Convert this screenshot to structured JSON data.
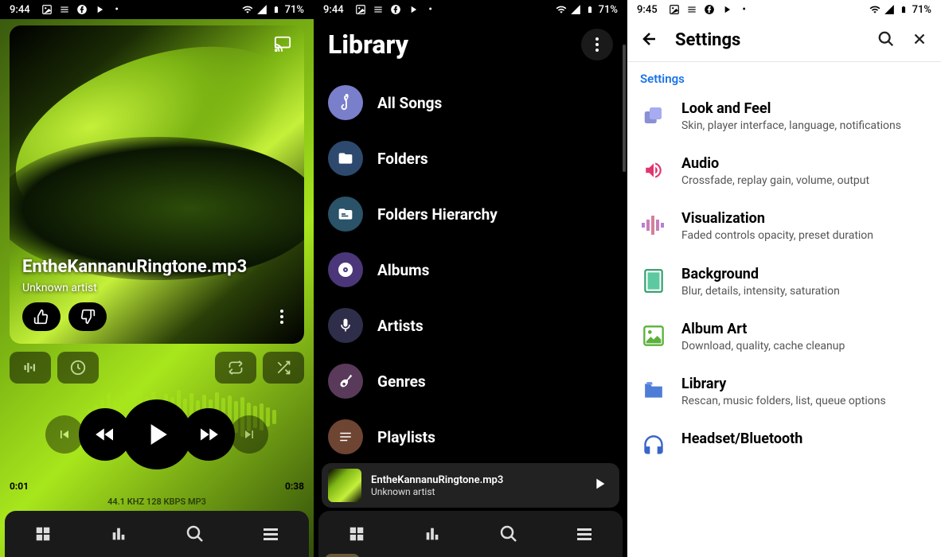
{
  "status": {
    "time1": "9:44",
    "time2": "9:44",
    "time3": "9:45",
    "battery": "71%"
  },
  "player": {
    "track_title": "EntheKannanuRingtone.mp3",
    "artist": "Unknown artist",
    "elapsed": "0:01",
    "total": "0:38",
    "format": "44.1 KHZ  128 KBPS  MP3"
  },
  "library": {
    "title": "Library",
    "items": [
      {
        "label": "All Songs",
        "icon": "treble-clef-icon",
        "color": "#7a7fcb"
      },
      {
        "label": "Folders",
        "icon": "folder-icon",
        "color": "#2d4a6e"
      },
      {
        "label": "Folders Hierarchy",
        "icon": "folder-tree-icon",
        "color": "#2a5268"
      },
      {
        "label": "Albums",
        "icon": "disc-icon",
        "color": "#4a3678"
      },
      {
        "label": "Artists",
        "icon": "mic-icon",
        "color": "#2e2e4a"
      },
      {
        "label": "Genres",
        "icon": "guitar-icon",
        "color": "#5a3a5a"
      },
      {
        "label": "Playlists",
        "icon": "list-icon",
        "color": "#6e4432"
      }
    ],
    "mini_title": "EntheKannanuRingtone.mp3",
    "mini_artist": "Unknown artist"
  },
  "settings": {
    "title": "Settings",
    "subtitle": "Settings",
    "items": [
      {
        "label": "Look and Feel",
        "desc": "Skin, player interface, language, notifications",
        "icon": "look-icon"
      },
      {
        "label": "Audio",
        "desc": "Crossfade, replay gain, volume, output",
        "icon": "audio-icon"
      },
      {
        "label": "Visualization",
        "desc": "Faded controls opacity, preset duration",
        "icon": "viz-icon"
      },
      {
        "label": "Background",
        "desc": "Blur, details, intensity, saturation",
        "icon": "bg-icon"
      },
      {
        "label": "Album Art",
        "desc": "Download, quality, cache cleanup",
        "icon": "art-icon"
      },
      {
        "label": "Library",
        "desc": "Rescan, music folders, list, queue options",
        "icon": "lib-icon"
      },
      {
        "label": "Headset/Bluetooth",
        "desc": "",
        "icon": "headset-icon"
      }
    ]
  }
}
